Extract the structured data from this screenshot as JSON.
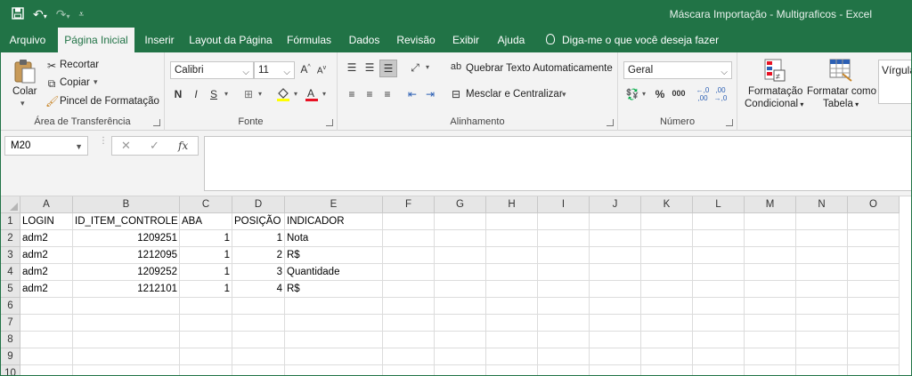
{
  "window": {
    "title": "Máscara Importação - Multigraficos  -  Excel"
  },
  "ribbon_tabs": [
    "Arquivo",
    "Página Inicial",
    "Inserir",
    "Layout da Página",
    "Fórmulas",
    "Dados",
    "Revisão",
    "Exibir",
    "Ajuda"
  ],
  "active_tab": "Página Inicial",
  "tell_me": "Diga-me o que você deseja fazer",
  "clipboard": {
    "paste": "Colar",
    "cut": "Recortar",
    "copy": "Copiar",
    "format_painter": "Pincel de Formatação",
    "label": "Área de Transferência"
  },
  "font": {
    "name": "Calibri",
    "size": "11",
    "grow": "A",
    "shrink": "A",
    "bold": "N",
    "italic": "I",
    "underline": "S",
    "label": "Fonte"
  },
  "alignment": {
    "wrap": "Quebrar Texto Automaticamente",
    "merge": "Mesclar e Centralizar",
    "label": "Alinhamento"
  },
  "number": {
    "format": "Geral",
    "percent": "%",
    "thousands": "000",
    "inc_decimal": "←,0\n,00",
    "label": "Número"
  },
  "styles": {
    "conditional_line1": "Formatação",
    "conditional_line2": "Condicional",
    "table_line1": "Formatar como",
    "table_line2": "Tabela",
    "cell_style": "Vírgula"
  },
  "formula_bar": {
    "name_box": "M20",
    "fx": "fx",
    "content": ""
  },
  "sheet": {
    "columns": [
      "A",
      "B",
      "C",
      "D",
      "E",
      "F",
      "G",
      "H",
      "I",
      "J",
      "K",
      "L",
      "M",
      "N",
      "O"
    ],
    "row_numbers": [
      "1",
      "2",
      "3",
      "4",
      "5",
      "6",
      "7",
      "8",
      "9",
      "10"
    ],
    "rows": [
      [
        "LOGIN",
        "ID_ITEM_CONTROLE",
        "ABA",
        "POSIÇÃO",
        "INDICADOR"
      ],
      [
        "adm2",
        "1209251",
        "1",
        "1",
        "Nota"
      ],
      [
        "adm2",
        "1212095",
        "1",
        "2",
        "R$"
      ],
      [
        "adm2",
        "1209252",
        "1",
        "3",
        "Quantidade"
      ],
      [
        "adm2",
        "1212101",
        "1",
        "4",
        "R$"
      ]
    ]
  },
  "colors": {
    "excel_green": "#217346",
    "ribbon_bg": "#f3f3f3"
  }
}
